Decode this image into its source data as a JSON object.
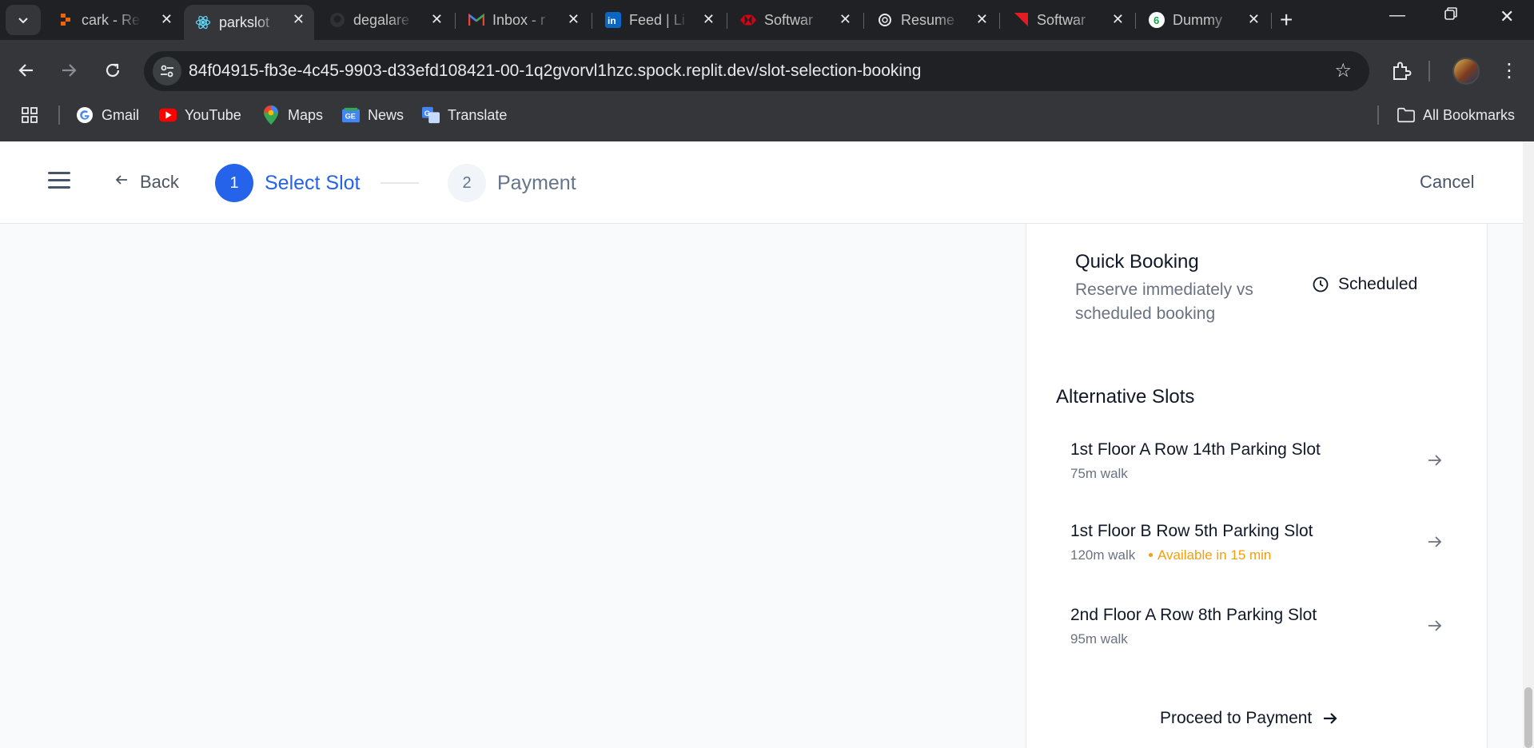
{
  "browser": {
    "tabs": [
      {
        "title": "cark - Re",
        "icon": "replit-icon",
        "active": false
      },
      {
        "title": "parkslot",
        "icon": "react-icon",
        "active": true
      },
      {
        "title": "degalare",
        "icon": "github-icon",
        "active": false
      },
      {
        "title": "Inbox - r",
        "icon": "gmail-icon",
        "active": false
      },
      {
        "title": "Feed | Li",
        "icon": "linkedin-icon",
        "active": false
      },
      {
        "title": "Softwar",
        "icon": "hsbc-icon",
        "active": false
      },
      {
        "title": "Resume",
        "icon": "openai-icon",
        "active": false
      },
      {
        "title": "Softwar",
        "icon": "red-flag-icon",
        "active": false
      },
      {
        "title": "Dummy",
        "icon": "dummy-site-icon",
        "active": false
      }
    ],
    "url": "84f04915-fb3e-4c45-9903-d33efd108421-00-1q2gvorvl1hzc.spock.replit.dev/slot-selection-booking",
    "bookmarks": [
      {
        "label": "Gmail",
        "icon": "google-icon"
      },
      {
        "label": "YouTube",
        "icon": "youtube-icon"
      },
      {
        "label": "Maps",
        "icon": "maps-icon"
      },
      {
        "label": "News",
        "icon": "news-icon"
      },
      {
        "label": "Translate",
        "icon": "translate-icon"
      }
    ],
    "all_bookmarks": "All Bookmarks"
  },
  "header": {
    "back_label": "Back",
    "steps": [
      {
        "number": "1",
        "label": "Select Slot",
        "state": "active"
      },
      {
        "number": "2",
        "label": "Payment",
        "state": "pending"
      }
    ],
    "cancel_label": "Cancel"
  },
  "quick_booking": {
    "title": "Quick Booking",
    "description": "Reserve immediately vs scheduled booking",
    "mode_label": "Scheduled"
  },
  "alternative_slots": {
    "title": "Alternative Slots",
    "slots": [
      {
        "name": "1st Floor A Row 14th Parking Slot",
        "walk": "75m walk",
        "availability": ""
      },
      {
        "name": "1st Floor B Row 5th Parking Slot",
        "walk": "120m walk",
        "availability": "Available in 15 min"
      },
      {
        "name": "2nd Floor A Row 8th Parking Slot",
        "walk": "95m walk",
        "availability": ""
      }
    ]
  },
  "proceed_label": "Proceed to Payment",
  "colors": {
    "primary": "#2563eb",
    "warning": "#f59e0b",
    "muted_text": "#6b7280",
    "chrome_dark": "#202124",
    "chrome_toolbar": "#35363a"
  }
}
